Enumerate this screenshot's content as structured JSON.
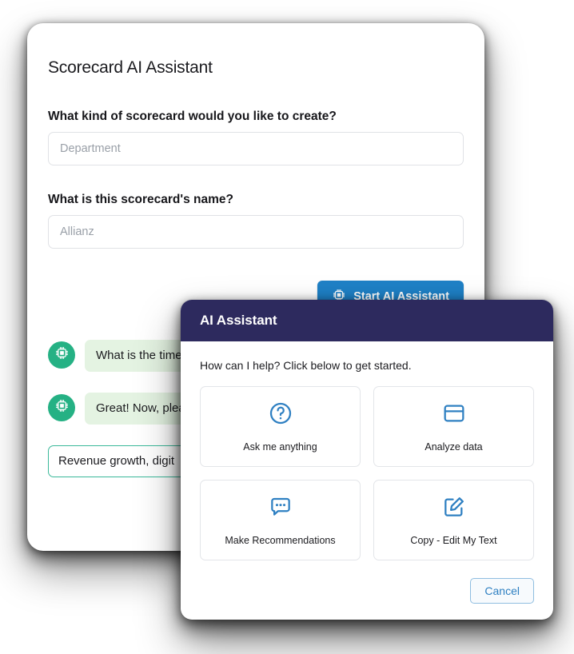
{
  "back_card": {
    "title": "Scorecard AI Assistant",
    "fields": [
      {
        "label": "What kind of scorecard would you like to create?",
        "placeholder": "Department",
        "value": ""
      },
      {
        "label": "What is this scorecard's name?",
        "placeholder": "Allianz",
        "value": ""
      }
    ],
    "primary_button": {
      "label": "Start AI Assistant",
      "icon": "ai-chip-icon",
      "color": "#1f81c6"
    },
    "chat": {
      "avatar_icon": "ai-chip-icon",
      "avatar_color": "#25b184",
      "bubble_color": "#e4f3e2",
      "messages": [
        {
          "text": "What is the time"
        },
        {
          "text": "Great! Now, plea accomplish dur"
        }
      ],
      "answer_input": {
        "value": "Revenue growth, digit",
        "border_color": "#3bb99a"
      }
    }
  },
  "modal": {
    "title": "AI Assistant",
    "header_color": "#2d2a5e",
    "prompt": "How can I help? Click below to get started.",
    "options": [
      {
        "label": "Ask me anything",
        "icon": "question-circle-icon"
      },
      {
        "label": "Analyze data",
        "icon": "table-card-icon"
      },
      {
        "label": "Make Recommendations",
        "icon": "chat-bubble-dots-icon"
      },
      {
        "label": "Copy - Edit My Text",
        "icon": "edit-square-pencil-icon"
      }
    ],
    "icon_color": "#2f80c2",
    "cancel_button": {
      "label": "Cancel",
      "color": "#2f80c2"
    }
  }
}
